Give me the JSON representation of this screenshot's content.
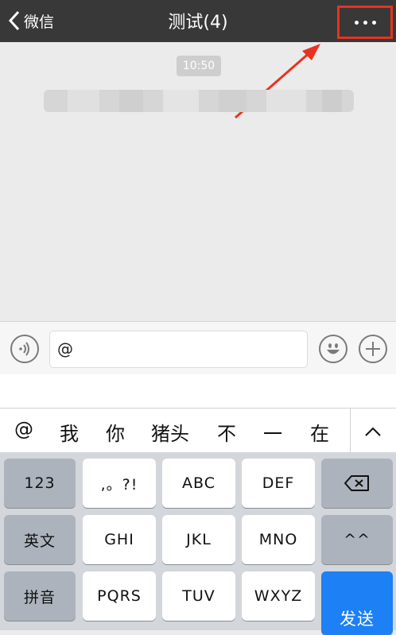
{
  "nav": {
    "back_label": "微信",
    "title": "测试(4)"
  },
  "chat": {
    "time": "10:50"
  },
  "input": {
    "text": "@"
  },
  "candidates": [
    "@",
    "我",
    "你",
    "猪头",
    "不",
    "一",
    "在"
  ],
  "keyboard": {
    "row1": [
      "123",
      ",。?!",
      "ABC",
      "DEF"
    ],
    "row2": [
      "英文",
      "GHI",
      "JKL",
      "MNO",
      "^^"
    ],
    "row3": [
      "拼音",
      "PQRS",
      "TUV",
      "WXYZ"
    ],
    "send": "发送"
  },
  "colors": {
    "nav_bg": "#383838",
    "highlight_red": "#e8321f",
    "send_blue": "#1d80f4"
  },
  "icons": [
    "chevron-left-icon",
    "more-icon",
    "voice-icon",
    "emoji-icon",
    "plus-icon",
    "chevron-up-icon",
    "delete-icon"
  ]
}
